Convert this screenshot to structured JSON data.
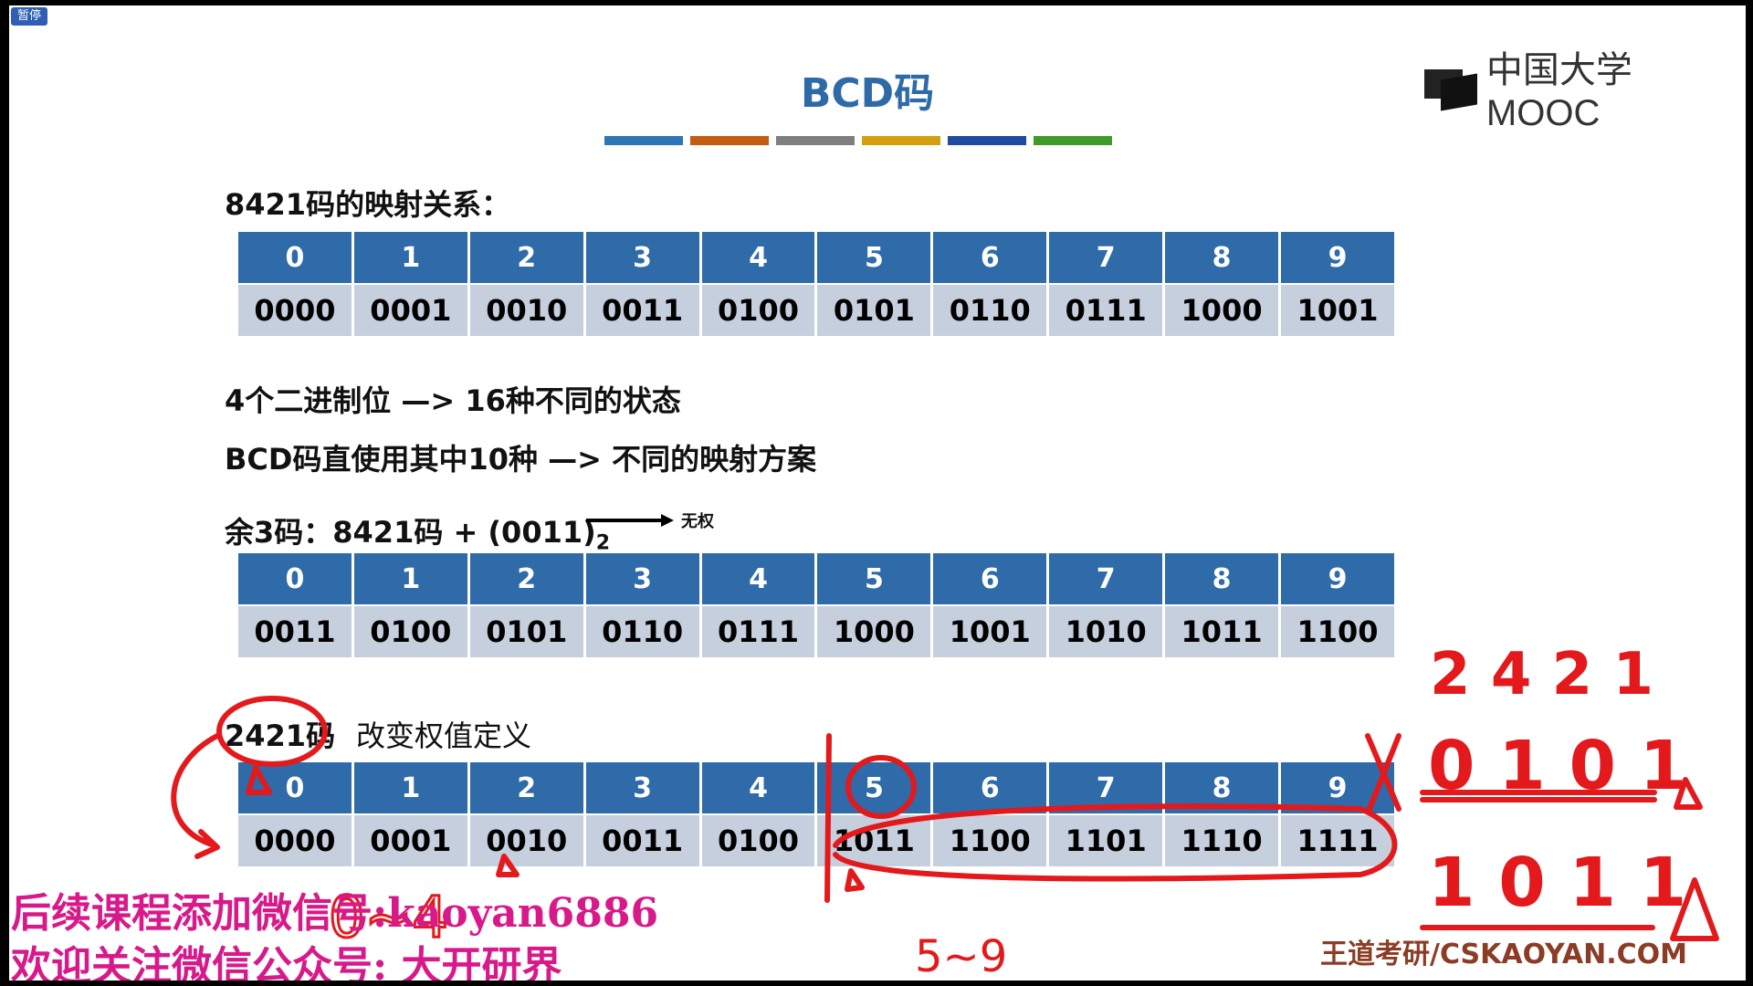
{
  "ui": {
    "pause_label": "暂停",
    "logo_text": "中国大学MOOC"
  },
  "slide": {
    "title": "BCD码",
    "title_bar_colors": [
      "#2e75b6",
      "#c55a11",
      "#7f7f7f",
      "#d4a010",
      "#1f4aa0",
      "#3f9a2a"
    ],
    "section1_heading": "8421码的映射关系：",
    "table1": {
      "headers": [
        "0",
        "1",
        "2",
        "3",
        "4",
        "5",
        "6",
        "7",
        "8",
        "9"
      ],
      "codes": [
        "0000",
        "0001",
        "0010",
        "0011",
        "0100",
        "0101",
        "0110",
        "0111",
        "1000",
        "1001"
      ]
    },
    "line_a": "4个二进制位 —> 16种不同的状态",
    "line_b": "BCD码直使用其中10种 —> 不同的映射方案",
    "excess3_label": "余3码：8421码 + (0011)",
    "excess3_subscript": "2",
    "excess3_note": "无权",
    "table2": {
      "headers": [
        "0",
        "1",
        "2",
        "3",
        "4",
        "5",
        "6",
        "7",
        "8",
        "9"
      ],
      "codes": [
        "0011",
        "0100",
        "0101",
        "0110",
        "0111",
        "1000",
        "1001",
        "1010",
        "1011",
        "1100"
      ]
    },
    "code2421_label": "2421码",
    "code2421_desc": "改变权值定义",
    "table3": {
      "headers": [
        "0",
        "1",
        "2",
        "3",
        "4",
        "5",
        "6",
        "7",
        "8",
        "9"
      ],
      "codes": [
        "0000",
        "0001",
        "0010",
        "0011",
        "0100",
        "1011",
        "1100",
        "1101",
        "1110",
        "1111"
      ]
    }
  },
  "annotations": {
    "weights": "2 4 2 1",
    "row1": "0 1 0 1",
    "row2": "1 0 1 1",
    "range_note": "0~4",
    "range_note2": "5~9",
    "ink_color": "#e3191c"
  },
  "overlay": {
    "watermark1": "后续课程添加微信号:kaoyan6886",
    "watermark2": "欢迎关注微信公众号: 大开研界",
    "credit": "王道考研/CSKAOYAN.COM"
  }
}
